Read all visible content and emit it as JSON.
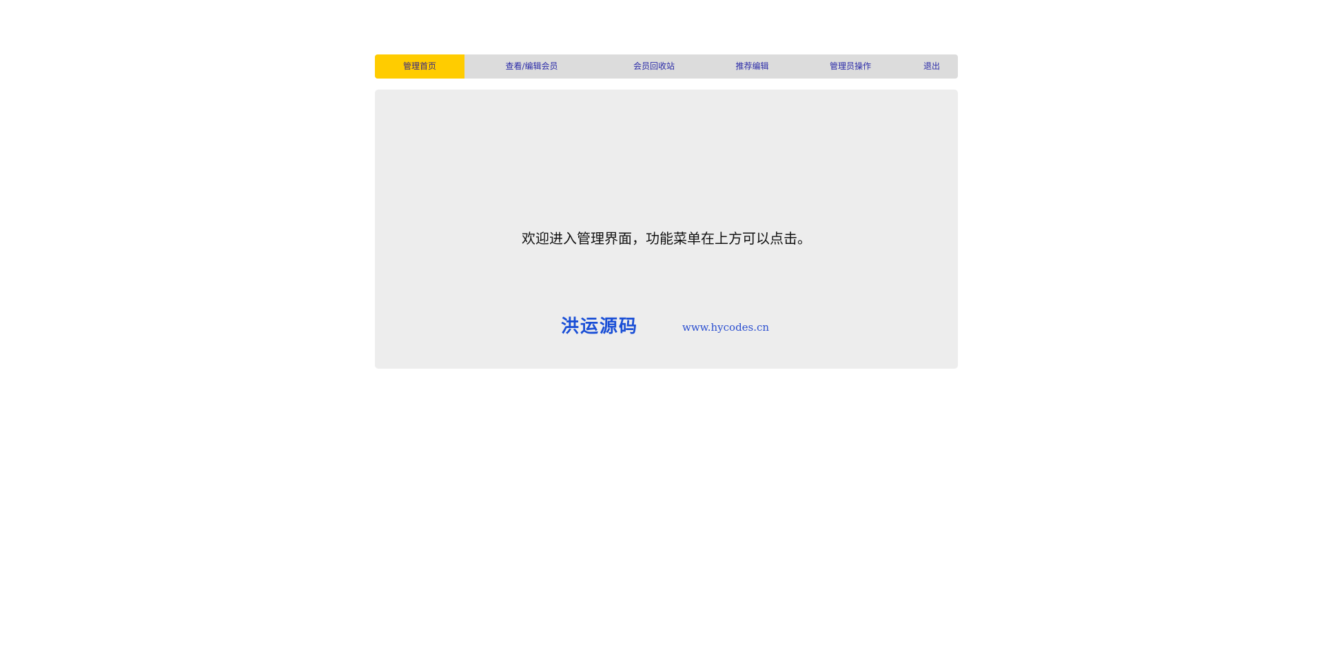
{
  "nav": {
    "items": [
      {
        "label": "管理首页",
        "active": true
      },
      {
        "label": "查看/编辑会员",
        "active": false
      },
      {
        "label": "会员回收站",
        "active": false
      },
      {
        "label": "推荐编辑",
        "active": false
      },
      {
        "label": "管理员操作",
        "active": false
      },
      {
        "label": "退出",
        "active": false
      }
    ]
  },
  "main": {
    "welcome_text": "欢迎进入管理界面，功能菜单在上方可以点击。",
    "brand_name": "洪运源码",
    "site_url": "www.hycodes.cn"
  },
  "colors": {
    "nav_bg": "#dcdcdc",
    "nav_active_bg": "#ffcc00",
    "nav_link": "#2b2ba8",
    "content_bg": "#ededed",
    "brand_blue": "#1a4fd6"
  }
}
